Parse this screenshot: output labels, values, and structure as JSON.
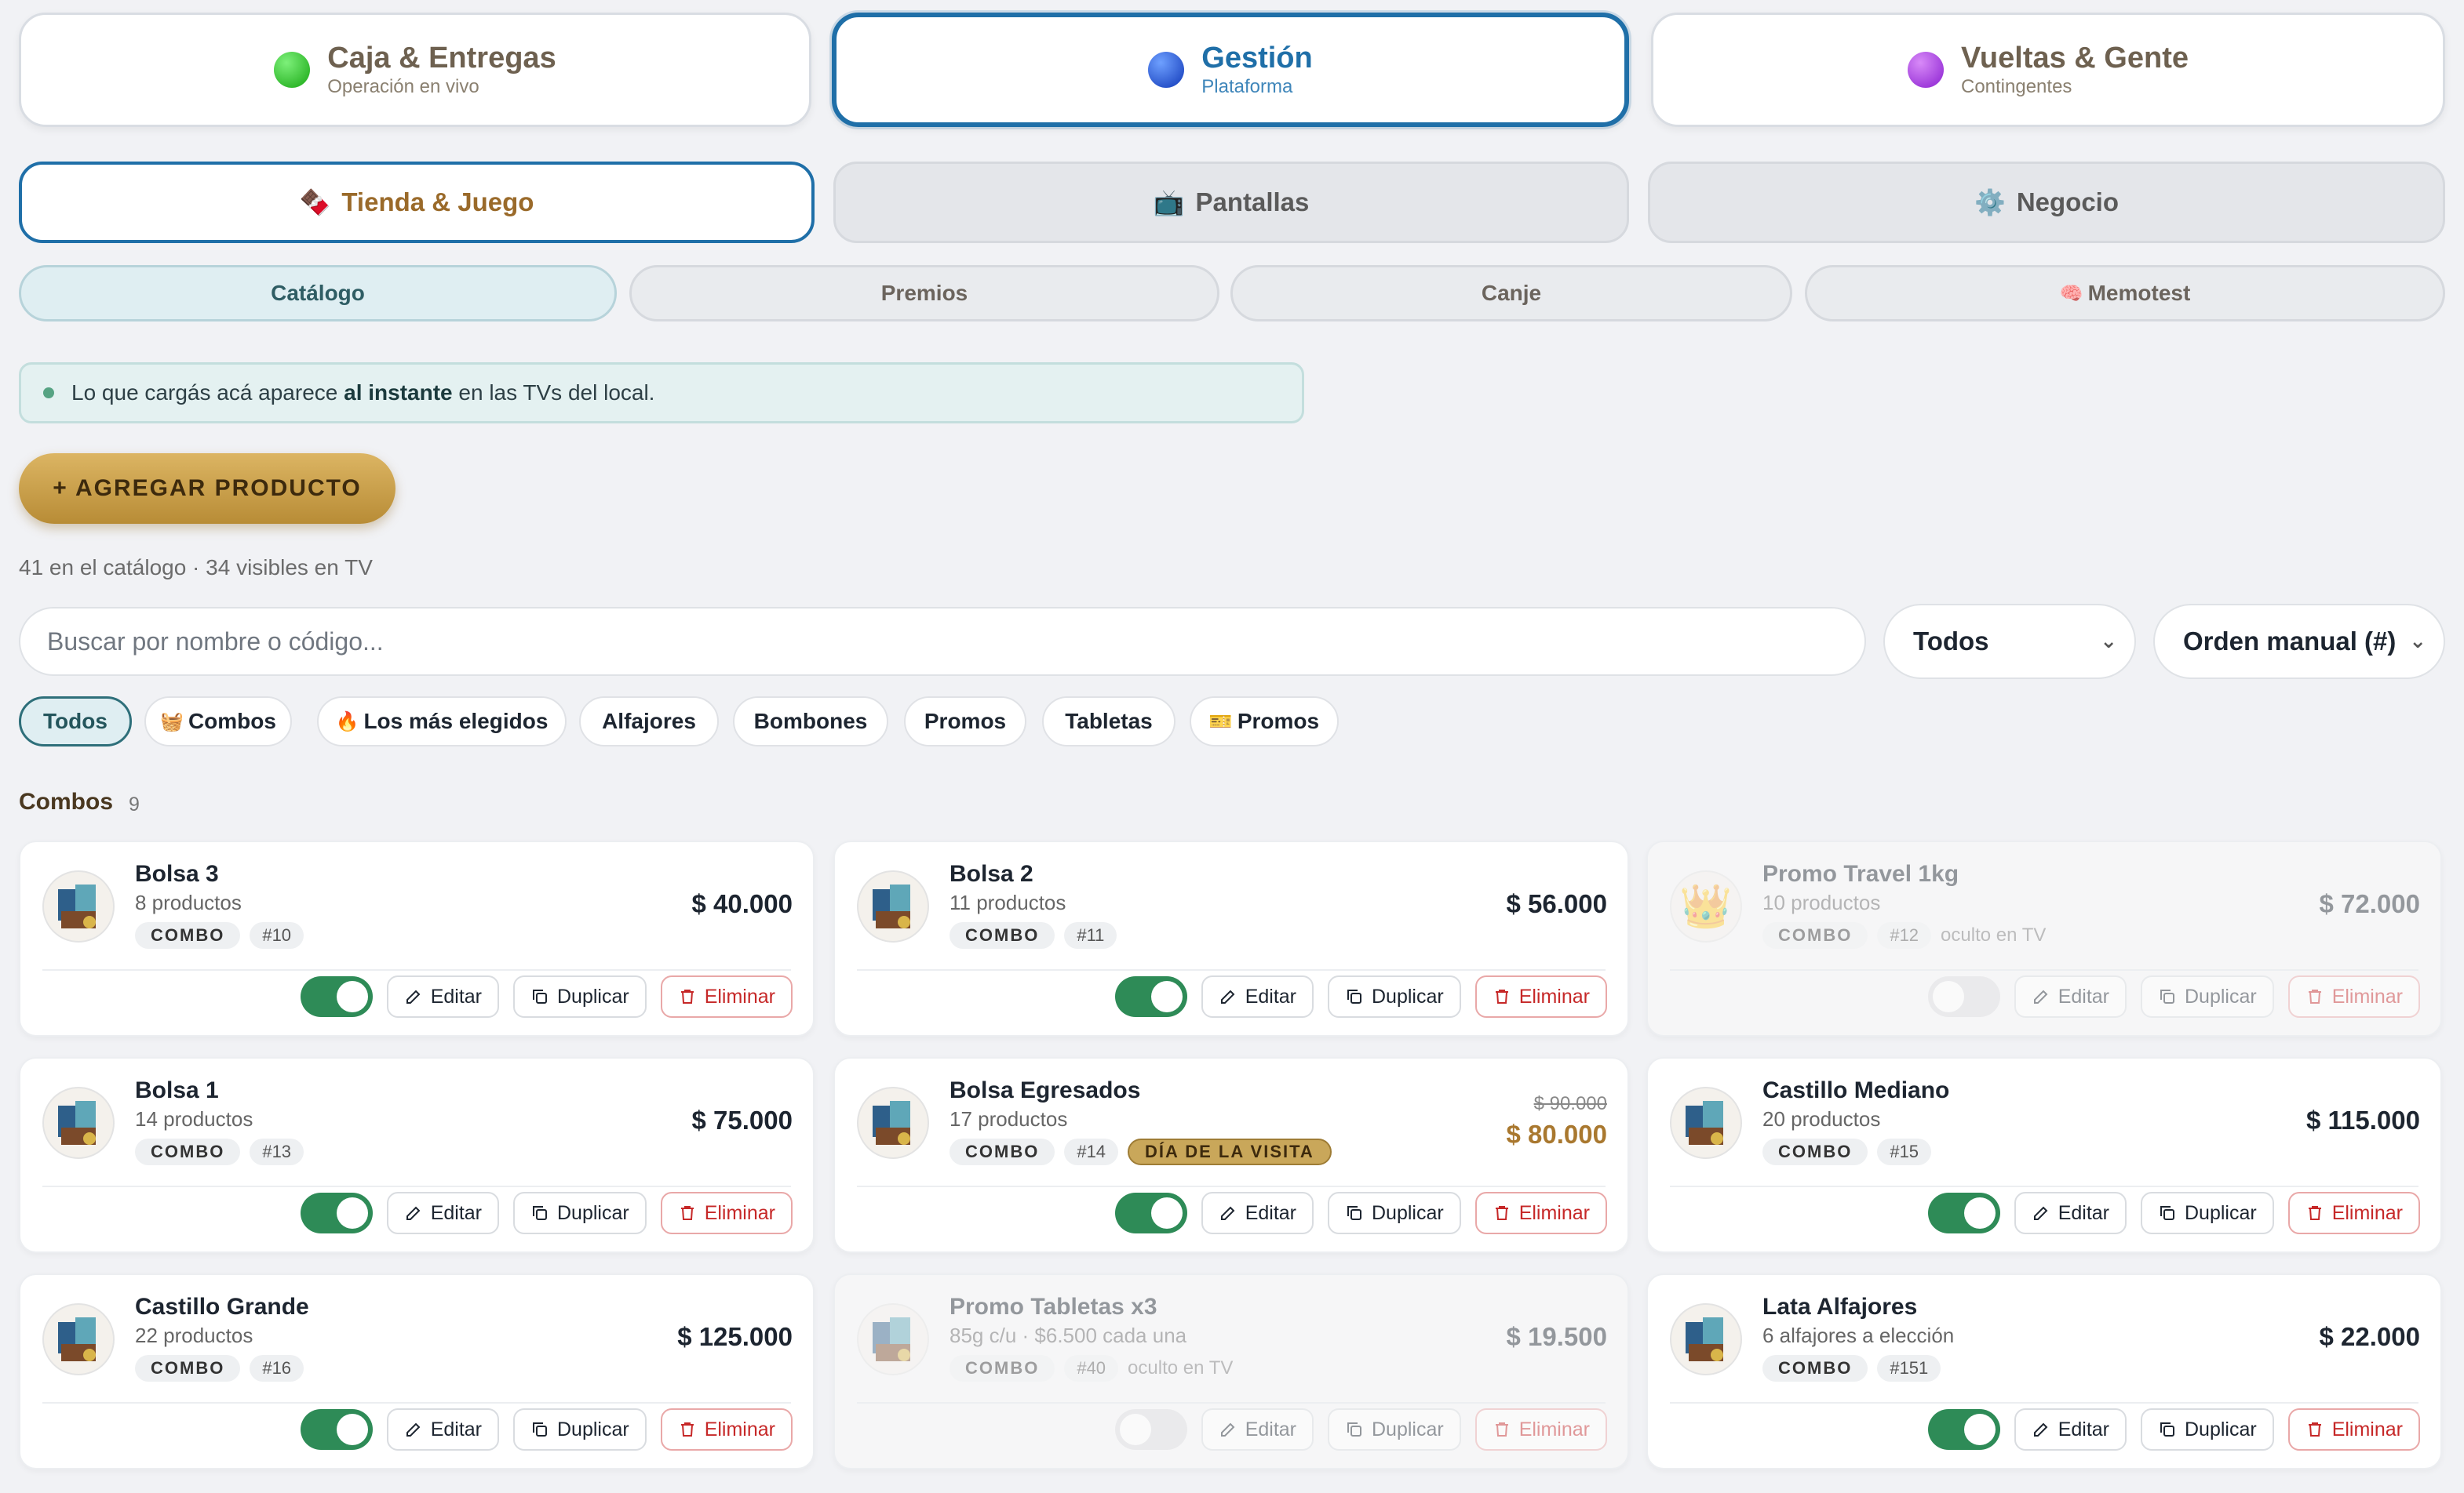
{
  "modes": [
    {
      "title": "Caja & Entregas",
      "subtitle": "Operación en vivo",
      "color": "#22c01a"
    },
    {
      "title": "Gestión",
      "subtitle": "Plataforma",
      "color": "#1a4fd6"
    },
    {
      "title": "Vueltas & Gente",
      "subtitle": "Contingentes",
      "color": "#a53ee6"
    }
  ],
  "sections": [
    {
      "label": "Tienda & Juego",
      "icon": "🍫"
    },
    {
      "label": "Pantallas",
      "icon": "📺"
    },
    {
      "label": "Negocio",
      "icon": "⚙️"
    }
  ],
  "subtabs": [
    {
      "label": "Catálogo"
    },
    {
      "label": "Premios"
    },
    {
      "label": "Canje"
    },
    {
      "label": "Memotest",
      "icon": "🧠"
    }
  ],
  "info": {
    "pre": "Lo que cargás acá aparece ",
    "bold": "al instante",
    "post": " en las TVs del local."
  },
  "add_button": "+ AGREGAR PRODUCTO",
  "count_text": "41 en el catálogo · 34 visibles en TV",
  "search": {
    "placeholder": "Buscar por nombre o código..."
  },
  "filter_select": "Todos",
  "order_select": "Orden manual (#)",
  "chips": [
    {
      "label": "Todos"
    },
    {
      "label": "Combos",
      "icon": "🧺"
    },
    {
      "label": "Los más elegidos",
      "icon": "🔥"
    },
    {
      "label": "Alfajores"
    },
    {
      "label": "Bombones"
    },
    {
      "label": "Promos"
    },
    {
      "label": "Tabletas"
    },
    {
      "label": "Promos",
      "icon": "🎫"
    }
  ],
  "section_title": "Combos",
  "section_count": "9",
  "actions": {
    "edit": "Editar",
    "duplicate": "Duplicar",
    "delete": "Eliminar"
  },
  "products": [
    {
      "name": "Bolsa 3",
      "desc": "8 productos",
      "tag": "COMBO",
      "num": "#10",
      "price": "$ 40.000",
      "active": true
    },
    {
      "name": "Bolsa 2",
      "desc": "11 productos",
      "tag": "COMBO",
      "num": "#11",
      "price": "$ 56.000",
      "active": true
    },
    {
      "name": "Promo Travel 1kg",
      "desc": "10 productos",
      "tag": "COMBO",
      "num": "#12",
      "price": "$ 72.000",
      "active": false,
      "hidden_label": "oculto en TV",
      "thumb": "👑"
    },
    {
      "name": "Bolsa 1",
      "desc": "14 productos",
      "tag": "COMBO",
      "num": "#13",
      "price": "$ 75.000",
      "active": true
    },
    {
      "name": "Bolsa Egresados",
      "desc": "17 productos",
      "tag": "COMBO",
      "num": "#14",
      "badge": "DÍA DE LA VISITA",
      "old_price": "$ 90.000",
      "price": "$ 80.000",
      "active": true
    },
    {
      "name": "Castillo Mediano",
      "desc": "20 productos",
      "tag": "COMBO",
      "num": "#15",
      "price": "$ 115.000",
      "active": true
    },
    {
      "name": "Castillo Grande",
      "desc": "22 productos",
      "tag": "COMBO",
      "num": "#16",
      "price": "$ 125.000",
      "active": true
    },
    {
      "name": "Promo Tabletas x3",
      "desc": "85g c/u · $6.500 cada una",
      "tag": "COMBO",
      "num": "#40",
      "price": "$ 19.500",
      "active": false,
      "hidden_label": "oculto en TV"
    },
    {
      "name": "Lata Alfajores",
      "desc": "6 alfajores a elección",
      "tag": "COMBO",
      "num": "#151",
      "price": "$ 22.000",
      "active": true
    }
  ]
}
